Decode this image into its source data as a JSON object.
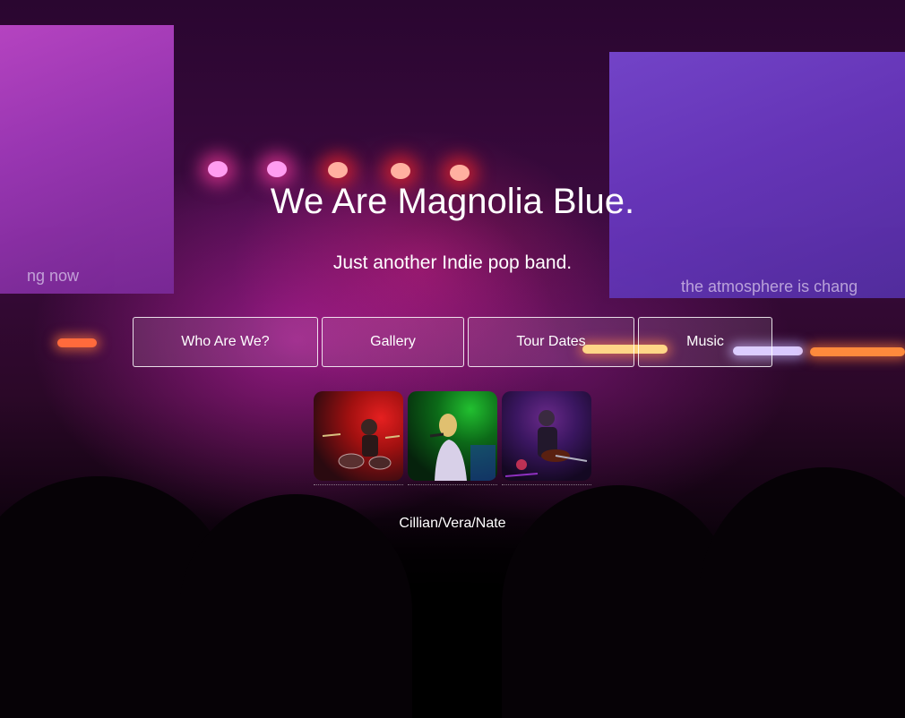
{
  "hero": {
    "title": "We Are Magnolia Blue.",
    "subtitle": "Just another Indie pop band."
  },
  "background": {
    "screen_left_text": "ng now",
    "screen_right_text": "the atmosphere is chang"
  },
  "nav": {
    "items": [
      {
        "label": "Who Are We?"
      },
      {
        "label": "Gallery"
      },
      {
        "label": "Tour Dates"
      },
      {
        "label": "Music"
      }
    ]
  },
  "members": {
    "photos": [
      {
        "subject": "drummer"
      },
      {
        "subject": "singer"
      },
      {
        "subject": "guitarist"
      }
    ],
    "caption": "Cillian/Vera/Nate"
  }
}
